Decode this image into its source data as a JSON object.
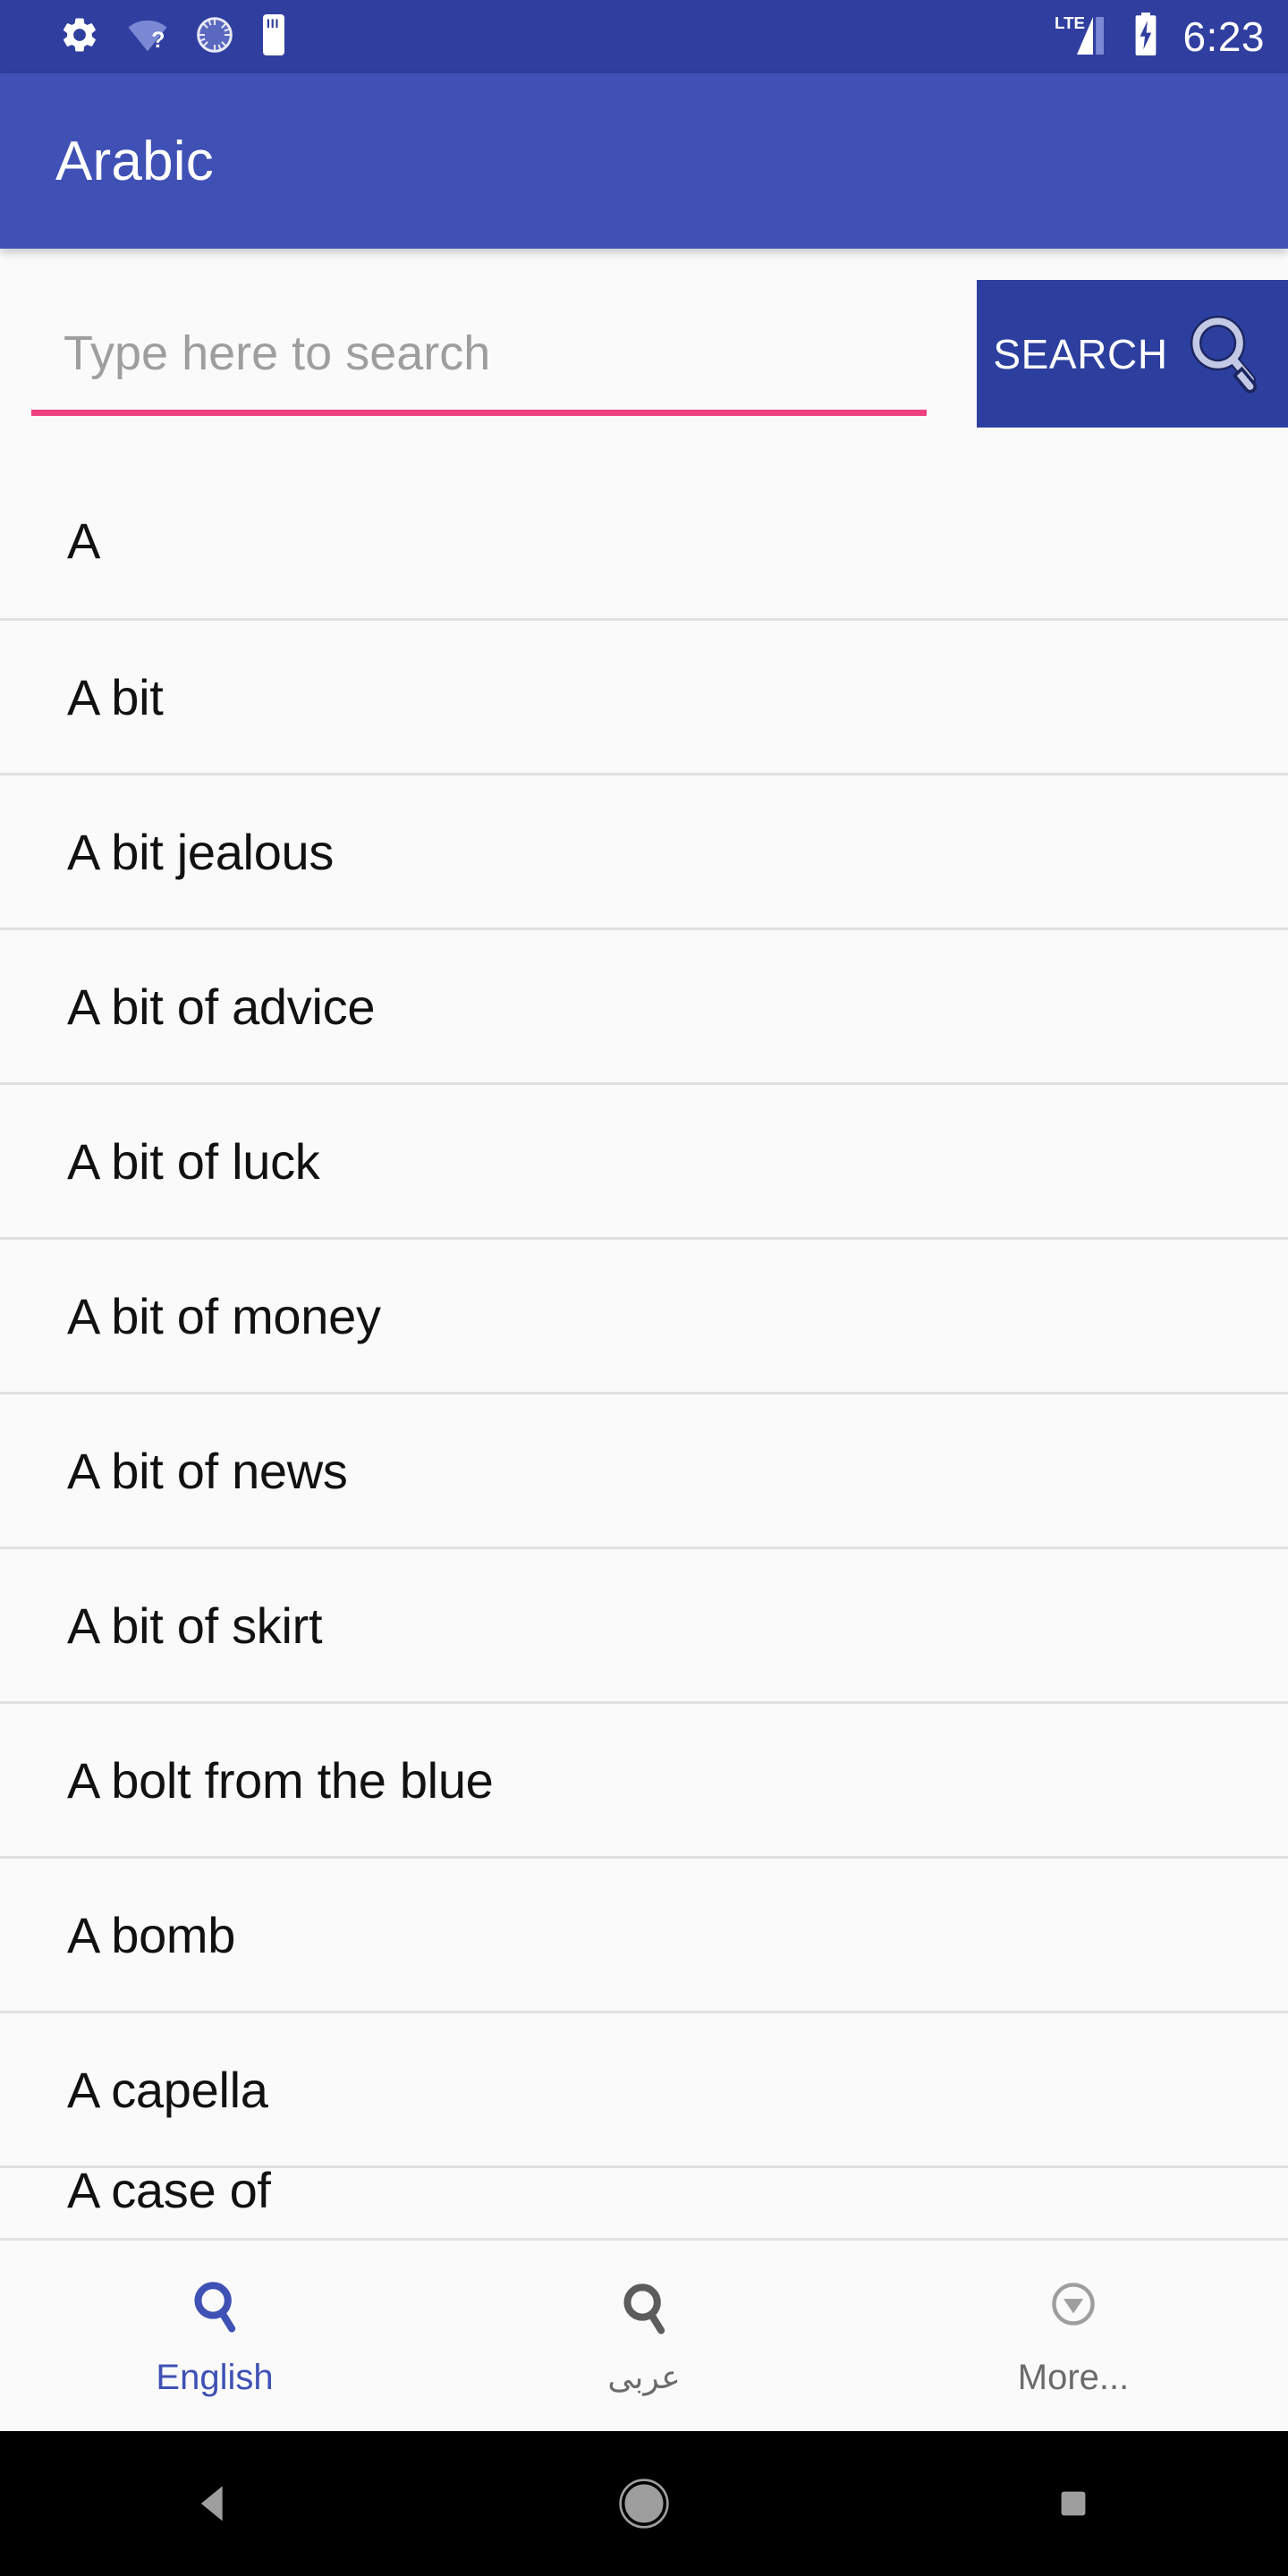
{
  "status_bar": {
    "background": "#303f9f",
    "time": "6:23",
    "left_icons": [
      "gear-icon",
      "wifi-question-icon",
      "sync-circle-icon",
      "sd-card-icon"
    ],
    "right_icons": [
      "lte-signal-icon",
      "battery-charging-icon"
    ],
    "network_label": "LTE"
  },
  "app_bar": {
    "title": "Arabic",
    "background": "#3f51b5",
    "text_color": "#ffffff"
  },
  "search": {
    "placeholder": "Type here to search",
    "value": "",
    "underline_color": "#ee3f7f",
    "button_label": "SEARCH",
    "button_background": "#2d3f9e",
    "button_icon": "magnifier-icon"
  },
  "list": {
    "items": [
      {
        "label": "A"
      },
      {
        "label": "A bit"
      },
      {
        "label": "A bit jealous"
      },
      {
        "label": "A bit of advice"
      },
      {
        "label": "A bit of luck"
      },
      {
        "label": "A bit of money"
      },
      {
        "label": "A bit of news"
      },
      {
        "label": "A bit of skirt"
      },
      {
        "label": "A bolt from the blue"
      },
      {
        "label": "A bomb"
      },
      {
        "label": "A capella"
      },
      {
        "label": "A case of"
      }
    ],
    "divider_color": "#e0e0e0",
    "background": "#fafafa"
  },
  "bottom_nav": {
    "active_color": "#3f51b5",
    "inactive_color": "#6b6b6b",
    "tabs": [
      {
        "label": "English",
        "icon": "magnifier-icon",
        "active": true
      },
      {
        "label": "عربى",
        "icon": "magnifier-icon",
        "active": false
      },
      {
        "label": "More...",
        "icon": "circle-chevron-down-icon",
        "active": false
      }
    ]
  },
  "system_nav": {
    "background": "#000000",
    "buttons": [
      "back-triangle-icon",
      "home-circle-icon",
      "recents-square-icon"
    ]
  }
}
